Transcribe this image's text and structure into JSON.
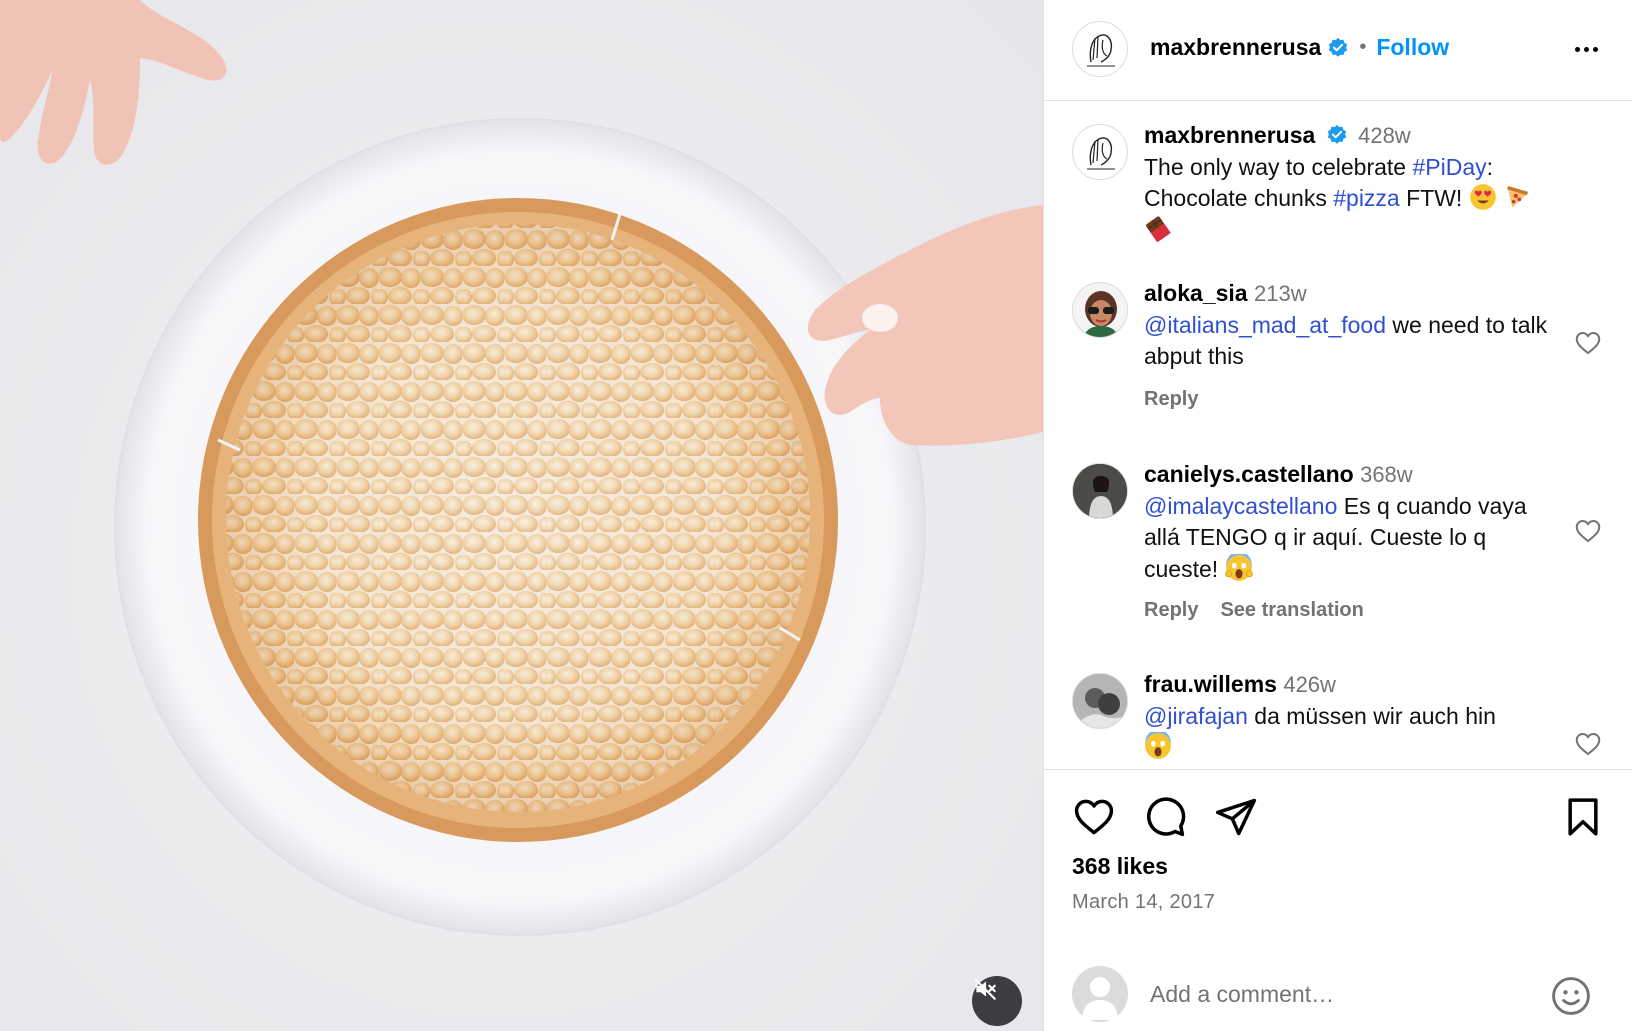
{
  "post": {
    "username": "maxbrennerusa",
    "follow_label": "Follow",
    "separator": "•",
    "caption": {
      "username": "maxbrennerusa",
      "time": "428w",
      "text_1": "The only way to celebrate ",
      "hashtag_1": "#PiDay",
      "text_2": ": Chocolate chunks ",
      "hashtag_2": "#pizza",
      "text_3": " FTW!"
    }
  },
  "comments": [
    {
      "username": "aloka_sia",
      "time": "213w",
      "mention": "@italians_mad_at_food",
      "text": " we need to talk abput this",
      "reply_label": "Reply"
    },
    {
      "username": "canielys.castellano",
      "time": "368w",
      "mention": "@imalaycastellano",
      "text": " Es q cuando vaya allá TENGO q ir aquí. Cueste lo q cueste!",
      "reply_label": "Reply",
      "translate_label": "See translation"
    },
    {
      "username": "frau.willems",
      "time": "426w",
      "mention": "@jirafajan",
      "text": " da müssen wir auch hin"
    }
  ],
  "stats": {
    "likes": "368 likes",
    "date": "March 14, 2017"
  },
  "composer": {
    "placeholder": "Add a comment…"
  },
  "icons": {
    "mute": "speaker-muted-icon",
    "like": "heart-icon",
    "comment": "comment-bubble-icon",
    "share": "paper-plane-icon",
    "save": "bookmark-icon",
    "emoji": "smiley-icon",
    "more": "more-horizontal-icon",
    "verified": "verified-badge-icon"
  },
  "colors": {
    "link": "#0095f6",
    "mention": "#2f4fd1",
    "muted": "#737373"
  }
}
